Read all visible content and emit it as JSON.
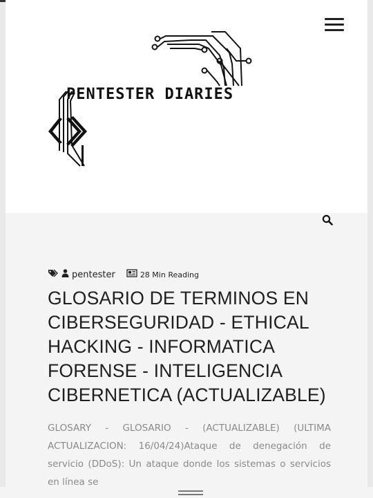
{
  "header": {
    "logo_text": "PENTESTER DIARIES",
    "menu_icon": "hamburger-icon"
  },
  "search": {
    "icon": "search-icon"
  },
  "post": {
    "tag_icon": "tag-icon",
    "user_icon": "user-icon",
    "author": "pentester",
    "reading_icon": "newspaper-icon",
    "reading_time": "28 Min Reading",
    "title": "GLOSARIO DE TERMINOS EN CIBERSEGURIDAD - ETHICAL HACKING - INFORMATICA FORENSE - INTELIGENCIA CIBERNETICA (ACTUALIZABLE)",
    "excerpt": " GLOSARY - GLOSARIO - (ACTUALIZABLE) (ULTIMA ACTUALIZACION: 16/04/24)Ataque de denegación de servicio (DDoS): Un ataque donde los sistemas o servicios en línea se"
  },
  "colors": {
    "accent": "#1f1f1f",
    "muted_text": "#8a8a8a",
    "header_bg": "#ffffff",
    "page_bg": "#f4f4f4"
  }
}
